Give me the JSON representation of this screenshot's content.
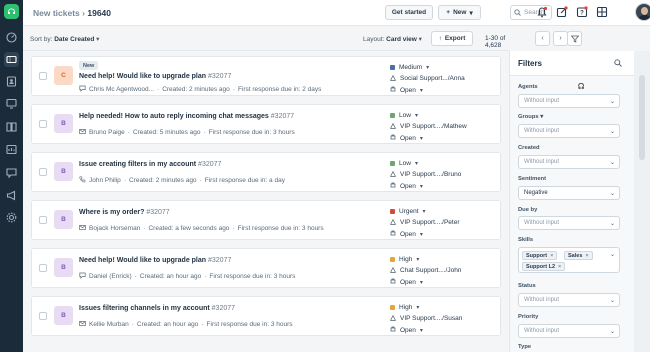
{
  "topbar": {
    "title": "New tickets",
    "ticket_id": "19640",
    "get_started_label": "Get started",
    "new_label": "New",
    "search_placeholder": "Search"
  },
  "toolbar": {
    "sort_prefix": "Sort by: ",
    "sort_value": "Date Created",
    "layout_prefix": "Layout: ",
    "layout_value": "Card view",
    "export_label": "Export",
    "pager_text": "1-30 of 4,628"
  },
  "tickets": [
    {
      "initials": "C",
      "avatar_bg": "#fbd9c7",
      "avatar_fg": "#d9662c",
      "badge": "New",
      "subject": "Need help! Would like to upgrade plan",
      "number": "#32077",
      "source_icon": "chat-icon",
      "requester": "Chris Mc Agentwood...",
      "created": "Created: 2 minutes ago",
      "response": "First response due in: 2 days",
      "priority": "Medium",
      "priority_color": "#4a6fa5",
      "group": "Social Support.../Anna",
      "status": "Open"
    },
    {
      "initials": "B",
      "avatar_bg": "#e8dcf5",
      "avatar_fg": "#7b5cc4",
      "badge": "",
      "subject": "Help needed! How to auto reply incoming chat messages",
      "number": "#32077",
      "source_icon": "email-icon",
      "requester": "Bruno Paige",
      "created": "Created: 5 minutes ago",
      "response": "First response due in: 3 hours",
      "priority": "Low",
      "priority_color": "#6fa66f",
      "group": "VIP Support..../Mathew",
      "status": "Open"
    },
    {
      "initials": "B",
      "avatar_bg": "#e8dcf5",
      "avatar_fg": "#7b5cc4",
      "badge": "",
      "subject": "Issue creating filters in my account",
      "number": "#32077",
      "source_icon": "phone-icon",
      "requester": "John Philip",
      "created": "Created: 2 minutes ago",
      "response": "First response due in: a day",
      "priority": "Low",
      "priority_color": "#6fa66f",
      "group": "VIP Support..../Bruno",
      "status": "Open"
    },
    {
      "initials": "B",
      "avatar_bg": "#e8dcf5",
      "avatar_fg": "#7b5cc4",
      "badge": "",
      "subject": "Where is my order?",
      "number": "#32077",
      "source_icon": "email-icon",
      "requester": "Bojack Horseman",
      "created": "Created: a few seconds ago",
      "response": "First response due in: 3 hours",
      "priority": "Urgent",
      "priority_color": "#d64a3a",
      "group": "VIP Support..../Peter",
      "status": "Open"
    },
    {
      "initials": "B",
      "avatar_bg": "#e8dcf5",
      "avatar_fg": "#7b5cc4",
      "badge": "",
      "subject": "Need help! Would like to upgrade plan",
      "number": "#32077",
      "source_icon": "chat-icon",
      "requester": "Daniel (Enrick)",
      "created": "Created: an hour ago",
      "response": "First response due in: 3 hours",
      "priority": "High",
      "priority_color": "#e8a63a",
      "group": "Chat Support..../John",
      "status": "Open"
    },
    {
      "initials": "B",
      "avatar_bg": "#e8dcf5",
      "avatar_fg": "#7b5cc4",
      "badge": "",
      "subject": "Issues filtering channels in my account",
      "number": "#32077",
      "source_icon": "email-icon",
      "requester": "Kellie Murban",
      "created": "Created: an hour ago",
      "response": "First response due in: 3 hours",
      "priority": "High",
      "priority_color": "#e8a63a",
      "group": "VIP Support..../Susan",
      "status": "Open"
    }
  ],
  "filters": {
    "title": "Filters",
    "agents_label": "Agents",
    "agents_value": "Without input",
    "groups_label": "Groups",
    "groups_value": "Without input",
    "created_label": "Created",
    "created_value": "Without input",
    "sentiment_label": "Sentiment",
    "sentiment_value": "Negative",
    "due_label": "Due by",
    "due_value": "Without input",
    "skills_label": "Skills",
    "skills": [
      "Support",
      "Sales",
      "Support L2"
    ],
    "status_label": "Status",
    "status_value": "Without input",
    "priority_label": "Priority",
    "priority_value": "Without input",
    "type_label": "Type"
  }
}
